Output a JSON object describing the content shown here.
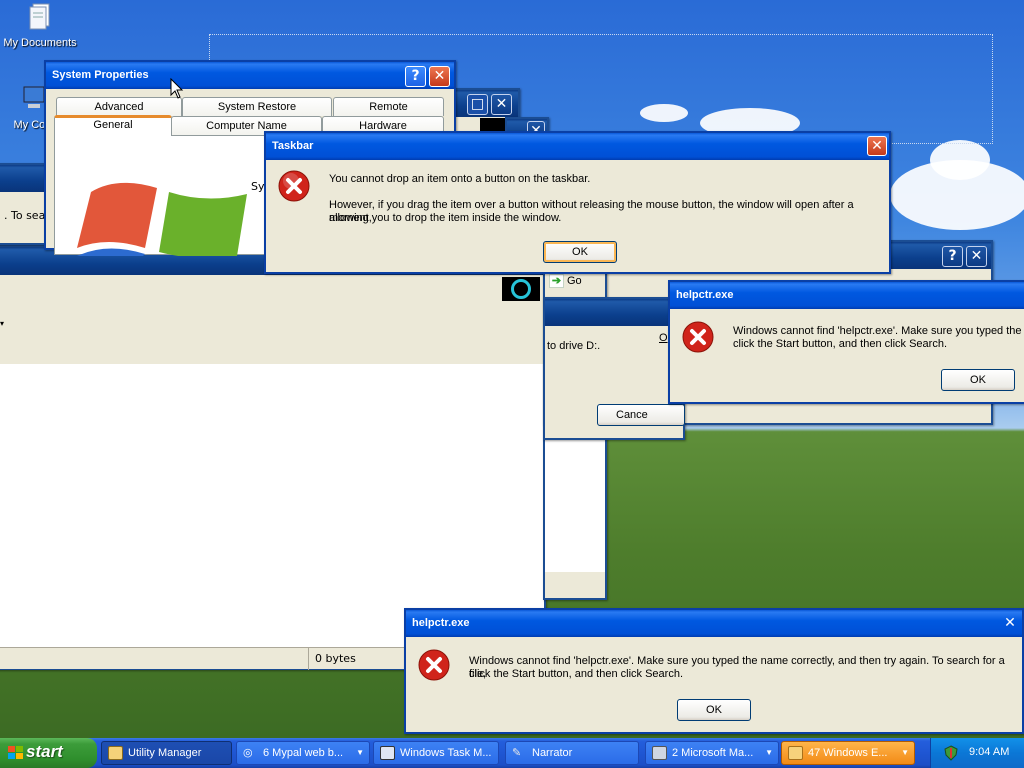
{
  "desktop": {
    "icons": [
      {
        "label": "My Documents",
        "icon": "my-documents-icon"
      },
      {
        "label": "My Com",
        "icon": "my-computer-icon"
      }
    ]
  },
  "system_properties": {
    "title": "System Properties",
    "tabs_row1": [
      "Advanced",
      "System Restore",
      "Remote"
    ],
    "tabs_row2": [
      "General",
      "Computer Name",
      "Hardware"
    ],
    "selected_tab": "General",
    "partial_text": "Sy"
  },
  "explorer": {
    "left_fragment": ". To sear",
    "go_label": "Go",
    "status_size": "0 bytes"
  },
  "back_dialog": {
    "text_fragment": "to drive D:.",
    "cancel_label": "Cance",
    "link_fragment": "O"
  },
  "taskbar_dialog": {
    "title": "Taskbar",
    "line1": "You cannot drop an item onto a button on the taskbar.",
    "line2": "However, if you drag the item over a button without releasing the mouse button, the window will open after a moment,",
    "line3": "allowing you to drop the item inside the window.",
    "ok_label": "OK"
  },
  "helpctr_dialog_1": {
    "title": "helpctr.exe",
    "line1": "Windows cannot find 'helpctr.exe'. Make sure you typed the n",
    "line2": "click the Start button, and then click Search.",
    "ok_label": "OK"
  },
  "helpctr_dialog_2": {
    "title": "helpctr.exe",
    "line1": "Windows cannot find 'helpctr.exe'. Make sure you typed the name correctly, and then try again. To search for a file,",
    "line2": "click the Start button, and then click Search.",
    "ok_label": "OK"
  },
  "taskbar": {
    "start_label": "start",
    "items": [
      {
        "label": "Utility Manager",
        "state": "active"
      },
      {
        "label": "6 Mypal web b...",
        "state": "normal",
        "group": true
      },
      {
        "label": "Windows Task M...",
        "state": "normal"
      },
      {
        "label": "Narrator",
        "state": "normal"
      },
      {
        "label": "2 Microsoft Ma...",
        "state": "normal",
        "group": true
      },
      {
        "label": "47 Windows E...",
        "state": "flash",
        "group": true
      }
    ],
    "clock": "9:04 AM"
  },
  "colors": {
    "titlebar": "#0058e0",
    "close_button": "#c4391a",
    "error_icon": "#d0241b",
    "start_green": "#3c9c3a",
    "flash_orange": "#f28a16"
  }
}
